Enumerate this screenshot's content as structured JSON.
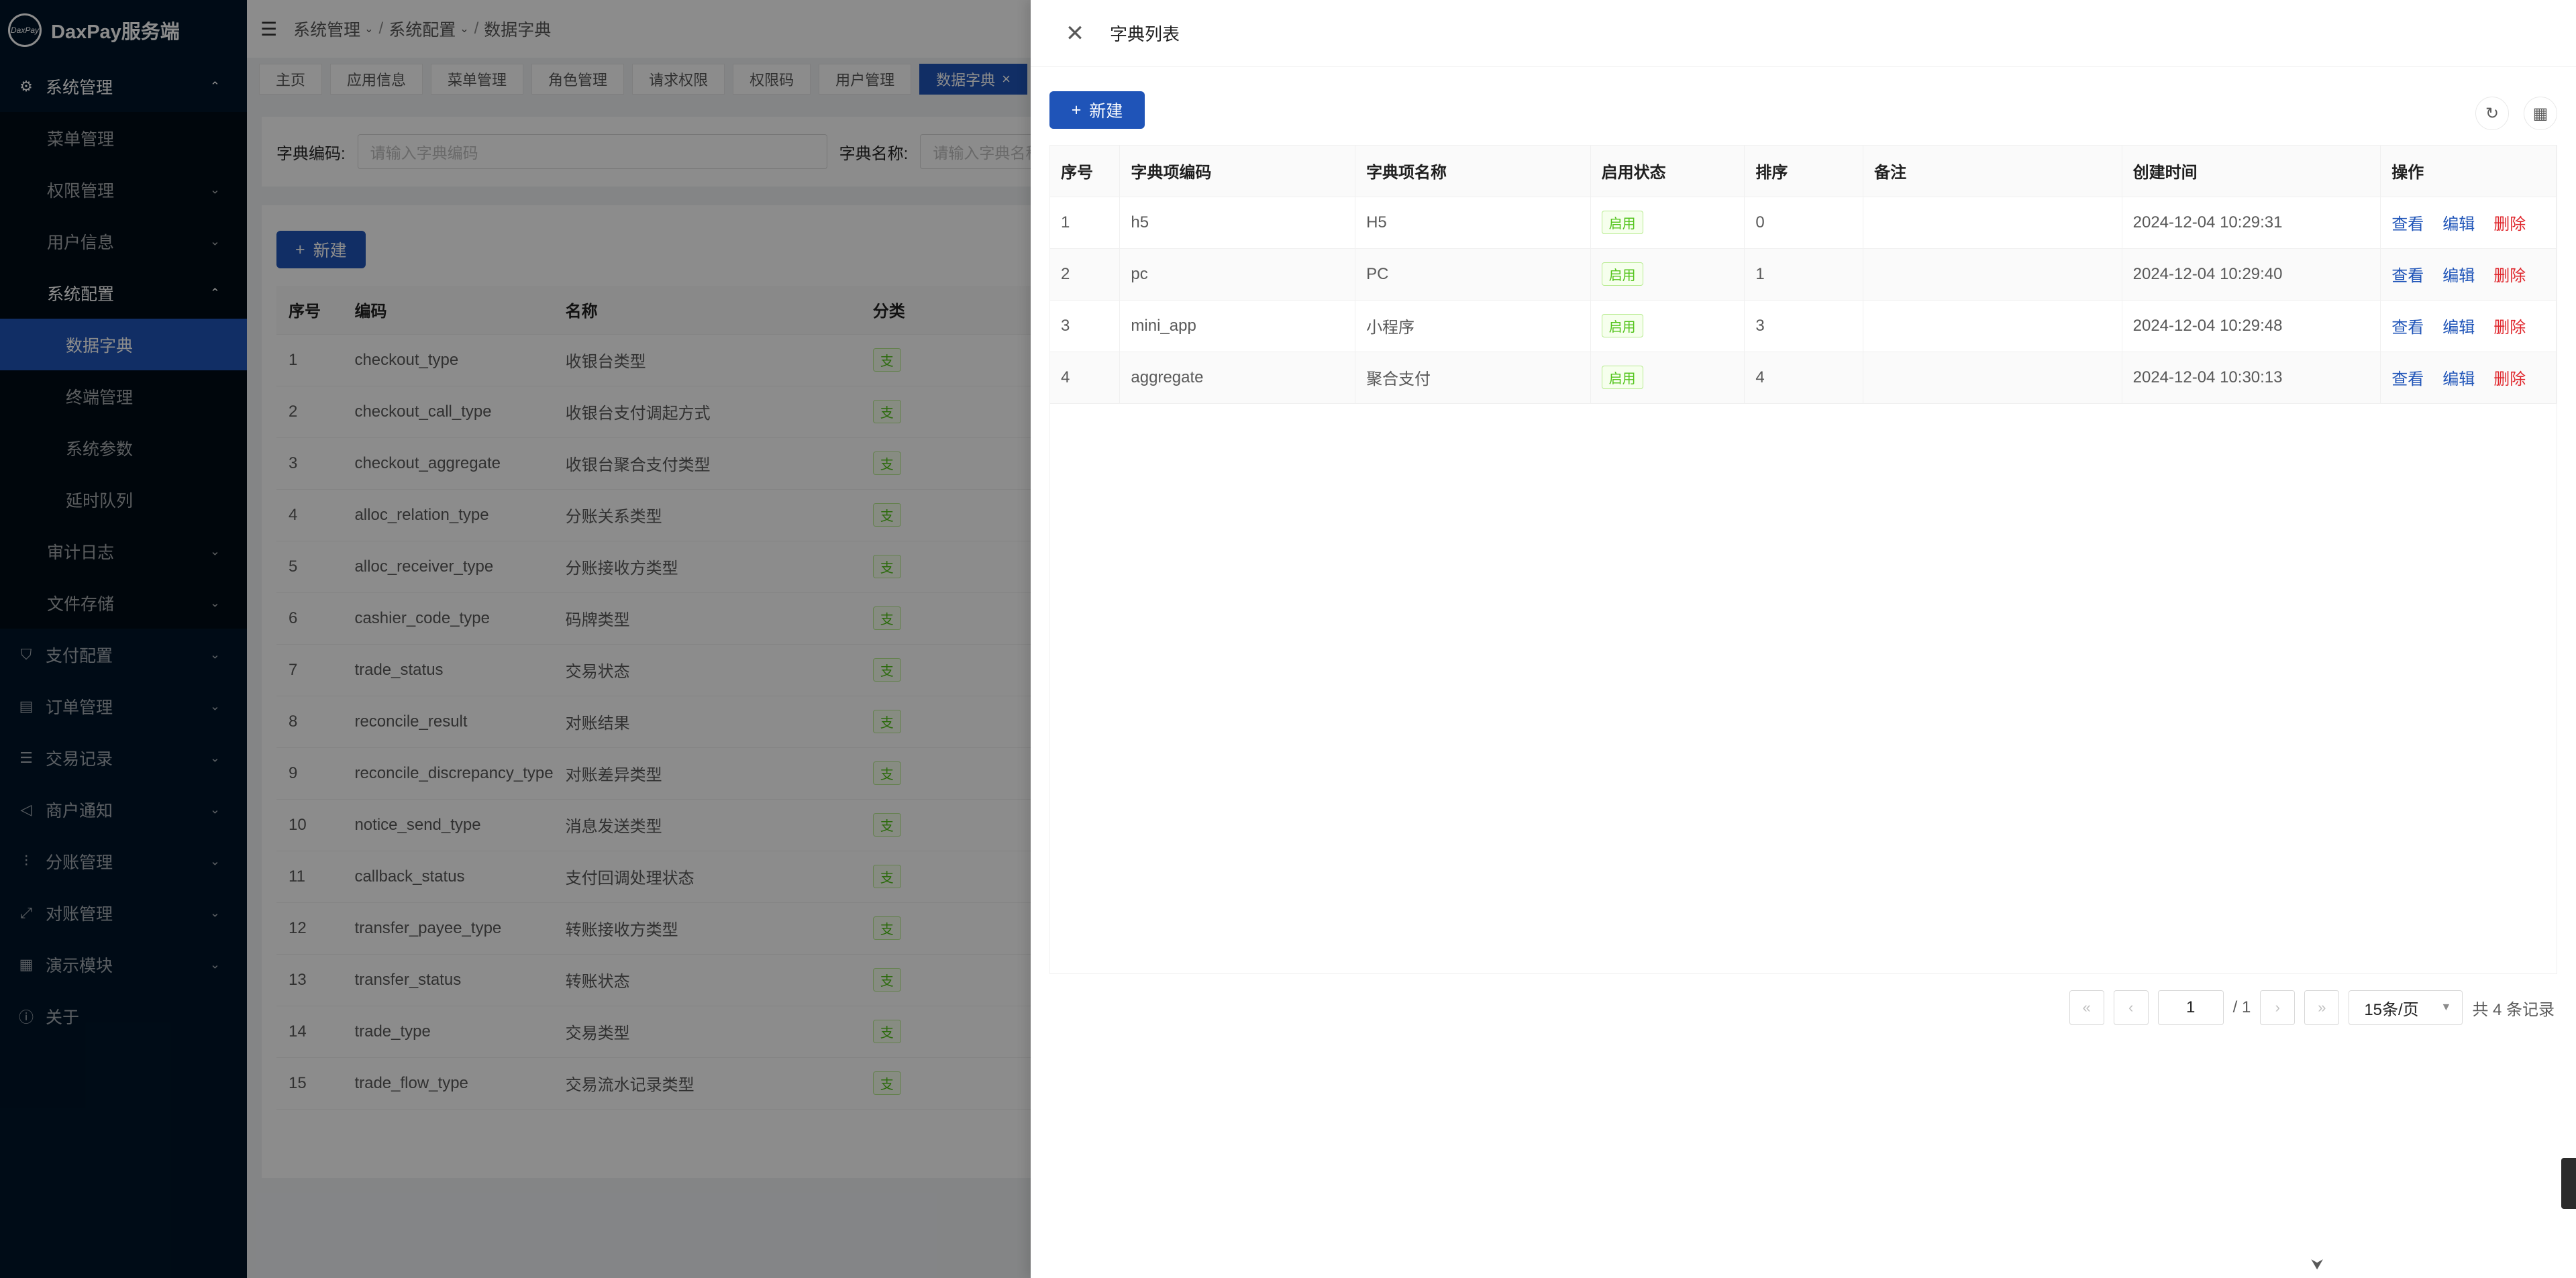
{
  "app": {
    "logo_mark": "DaxPay",
    "title": "DaxPay服务端"
  },
  "sidebar": {
    "items": [
      {
        "label": "系统管理",
        "icon": "gear-icon",
        "level": 1,
        "state": "open"
      },
      {
        "label": "菜单管理",
        "level": 2
      },
      {
        "label": "权限管理",
        "level": 2,
        "arrow": true
      },
      {
        "label": "用户信息",
        "level": 2,
        "arrow": true
      },
      {
        "label": "系统配置",
        "level": 2,
        "state": "open"
      },
      {
        "label": "数据字典",
        "level": 3,
        "state": "active"
      },
      {
        "label": "终端管理",
        "level": 3
      },
      {
        "label": "系统参数",
        "level": 3
      },
      {
        "label": "延时队列",
        "level": 3
      },
      {
        "label": "审计日志",
        "level": 2,
        "arrow": true
      },
      {
        "label": "文件存储",
        "level": 2,
        "arrow": true
      },
      {
        "label": "支付配置",
        "icon": "shield-icon",
        "level": 1,
        "arrow": true
      },
      {
        "label": "订单管理",
        "icon": "order-icon",
        "level": 1,
        "arrow": true
      },
      {
        "label": "交易记录",
        "icon": "record-icon",
        "level": 1,
        "arrow": true
      },
      {
        "label": "商户通知",
        "icon": "notify-icon",
        "level": 1,
        "arrow": true
      },
      {
        "label": "分账管理",
        "icon": "split-icon",
        "level": 1,
        "arrow": true
      },
      {
        "label": "对账管理",
        "icon": "reconcile-icon",
        "level": 1,
        "arrow": true
      },
      {
        "label": "演示模块",
        "icon": "grid-icon",
        "level": 1,
        "arrow": true
      },
      {
        "label": "关于",
        "icon": "info-icon",
        "level": 1
      }
    ]
  },
  "breadcrumb": [
    "系统管理",
    "系统配置",
    "数据字典"
  ],
  "tabs": [
    {
      "label": "主页"
    },
    {
      "label": "应用信息"
    },
    {
      "label": "菜单管理"
    },
    {
      "label": "角色管理"
    },
    {
      "label": "请求权限"
    },
    {
      "label": "权限码"
    },
    {
      "label": "用户管理"
    },
    {
      "label": "数据字典",
      "active": true
    }
  ],
  "search": {
    "code_label": "字典编码:",
    "code_placeholder": "请输入字典编码",
    "name_label": "字典名称:",
    "name_placeholder": "请输入字典名称"
  },
  "main_list": {
    "new_button": "新建",
    "columns": [
      "序号",
      "编码",
      "名称",
      "分类"
    ],
    "rows": [
      [
        "1",
        "checkout_type",
        "收银台类型",
        "支"
      ],
      [
        "2",
        "checkout_call_type",
        "收银台支付调起方式",
        "支"
      ],
      [
        "3",
        "checkout_aggregate",
        "收银台聚合支付类型",
        "支"
      ],
      [
        "4",
        "alloc_relation_type",
        "分账关系类型",
        "支"
      ],
      [
        "5",
        "alloc_receiver_type",
        "分账接收方类型",
        "支"
      ],
      [
        "6",
        "cashier_code_type",
        "码牌类型",
        "支"
      ],
      [
        "7",
        "trade_status",
        "交易状态",
        "支"
      ],
      [
        "8",
        "reconcile_result",
        "对账结果",
        "支"
      ],
      [
        "9",
        "reconcile_discrepancy_type",
        "对账差异类型",
        "支"
      ],
      [
        "10",
        "notice_send_type",
        "消息发送类型",
        "支"
      ],
      [
        "11",
        "callback_status",
        "支付回调处理状态",
        "支"
      ],
      [
        "12",
        "transfer_payee_type",
        "转账接收方类型",
        "支"
      ],
      [
        "13",
        "transfer_status",
        "转账状态",
        "支"
      ],
      [
        "14",
        "trade_type",
        "交易类型",
        "支"
      ],
      [
        "15",
        "trade_flow_type",
        "交易流水记录类型",
        "支"
      ]
    ]
  },
  "drawer": {
    "title": "字典列表",
    "new_button": "新建",
    "columns": [
      "序号",
      "字典项编码",
      "字典项名称",
      "启用状态",
      "排序",
      "备注",
      "创建时间",
      "操作"
    ],
    "rows": [
      {
        "no": "1",
        "code": "h5",
        "name": "H5",
        "status": "启用",
        "sort": "0",
        "remark": "",
        "created": "2024-12-04 10:29:31"
      },
      {
        "no": "2",
        "code": "pc",
        "name": "PC",
        "status": "启用",
        "sort": "1",
        "remark": "",
        "created": "2024-12-04 10:29:40"
      },
      {
        "no": "3",
        "code": "mini_app",
        "name": "小程序",
        "status": "启用",
        "sort": "3",
        "remark": "",
        "created": "2024-12-04 10:29:48"
      },
      {
        "no": "4",
        "code": "aggregate",
        "name": "聚合支付",
        "status": "启用",
        "sort": "4",
        "remark": "",
        "created": "2024-12-04 10:30:13"
      }
    ],
    "actions": {
      "view": "查看",
      "edit": "编辑",
      "delete": "删除"
    },
    "pager": {
      "current": "1",
      "total_pages": "/ 1",
      "page_size": "15条/页",
      "total": "共 4 条记录"
    }
  }
}
